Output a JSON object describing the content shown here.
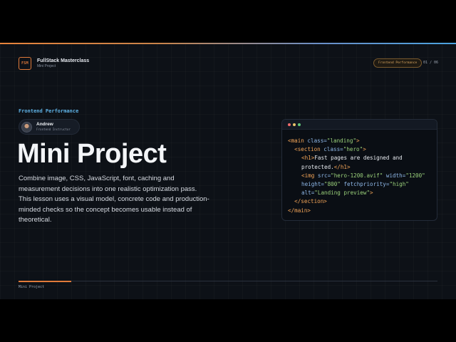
{
  "header": {
    "brand_logo_text": "FSM",
    "brand_title": "FullStack Masterclass",
    "brand_subtitle": "Mini Project",
    "topic_badge": "Frontend Performance",
    "page_counter": "01 / 06"
  },
  "main": {
    "eyebrow": "Frontend Performance",
    "instructor": {
      "name": "Andrew",
      "role": "Frontend Instructor"
    },
    "title": "Mini Project",
    "description": "Combine image, CSS, JavaScript, font, caching and measurement decisions into one realistic optimization pass. This lesson uses a visual model, concrete code and production-minded checks so the concept becomes usable instead of theoretical."
  },
  "code": {
    "l1_open": "<main",
    "l1_attr": " class=",
    "l1_val": "\"landing\"",
    "l1_close": ">",
    "l2_open": "<section",
    "l2_attr": " class=",
    "l2_val": "\"hero\"",
    "l2_close": ">",
    "l3_open": "<h1>",
    "l3_text": "Fast pages are designed and protected.",
    "l3_close": "</h1>",
    "l4_open": "<img",
    "l4_attr1": " src=",
    "l4_val1": "\"hero-1200.avif\"",
    "l4_attr2": " width=",
    "l4_val2": "\"1200\"",
    "l4_attr3": "height=",
    "l4_val3": "\"800\"",
    "l4_attr4": " fetchpriority=",
    "l4_val4": "\"high\"",
    "l4_attr5": "alt=",
    "l4_val5": "\"Landing preview\"",
    "l4_close": ">",
    "l5_close": "</section>",
    "l6_close": "</main>"
  },
  "footer": {
    "label": "Mini Project",
    "progress": 0.125
  },
  "colors": {
    "accent": "#e07a3a",
    "link": "#5fb3e6",
    "background": "#0d1117"
  }
}
